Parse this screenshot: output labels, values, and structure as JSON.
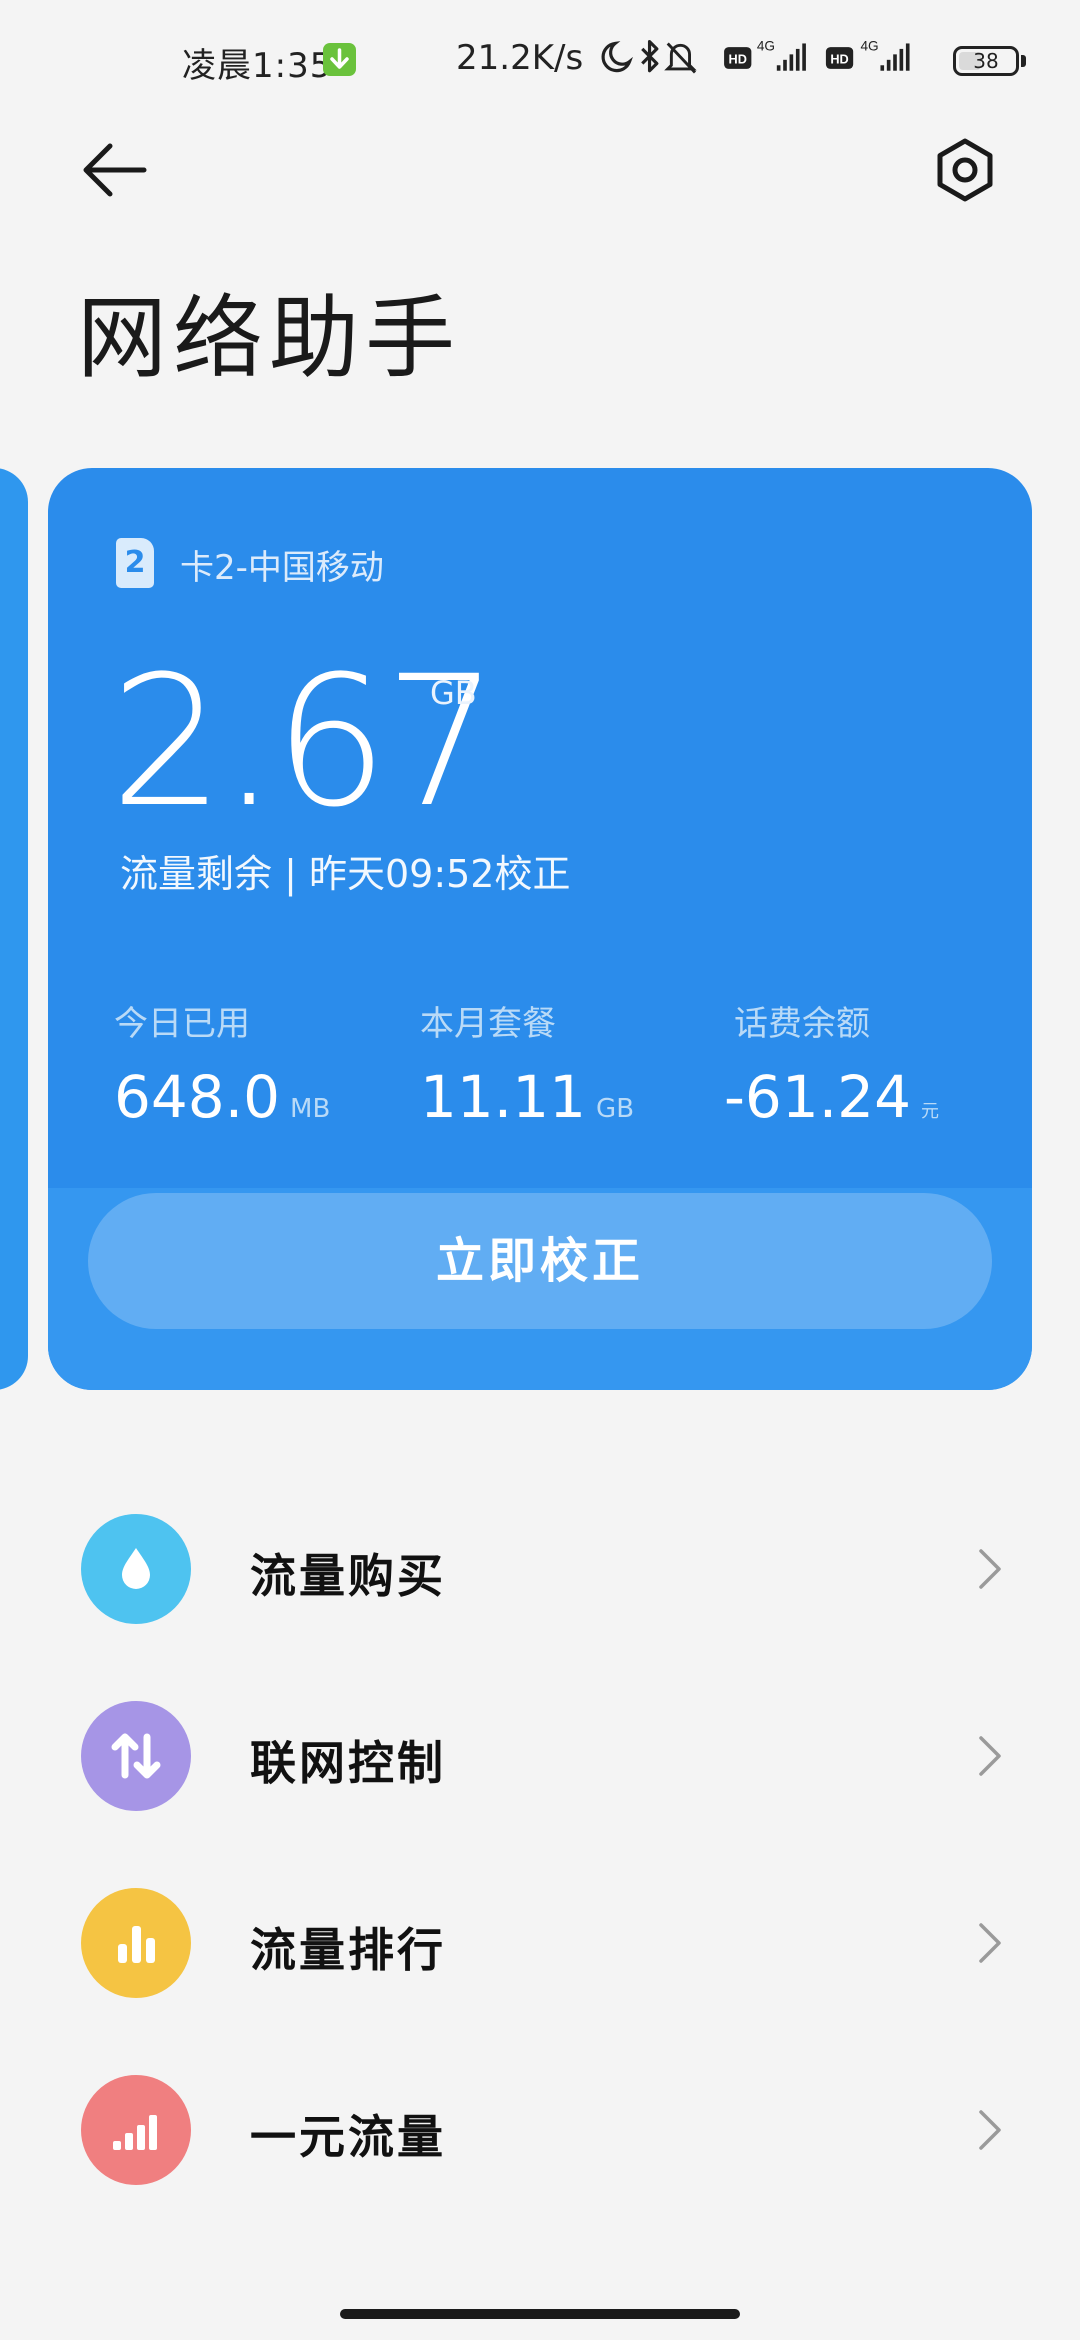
{
  "status_bar": {
    "time": "凌晨1:35",
    "net_speed": "21.2K/s",
    "battery": "38",
    "icons": [
      "download-icon",
      "moon-icon",
      "bluetooth-icon",
      "mute-icon",
      "hd-icon",
      "4g-signal-icon",
      "hd-icon",
      "4g-signal-icon",
      "battery-icon"
    ]
  },
  "header": {
    "title": "网络助手",
    "back_icon": "back-arrow-icon",
    "settings_icon": "settings-hex-icon"
  },
  "card": {
    "sim_number": "2",
    "carrier": "卡2-中国移动",
    "remaining_value": "2.67",
    "remaining_unit": "GB",
    "remaining_line": "流量剩余 | 昨天09:52校正",
    "stats": [
      {
        "label": "今日已用",
        "value": "648.0",
        "unit": "MB"
      },
      {
        "label": "本月套餐",
        "value": "11.11",
        "unit": "GB"
      },
      {
        "label": "话费余额",
        "value": "-61.24",
        "unit": "元"
      }
    ],
    "button": "立即校正",
    "colors": {
      "card_bg": "#2b8ceb",
      "peek_card_bg": "#2f97ee"
    }
  },
  "menu": [
    {
      "label": "流量购买",
      "icon": "water-drop-icon",
      "color": "#4ec3f0"
    },
    {
      "label": "联网控制",
      "icon": "up-down-arrows-icon",
      "color": "#a695e6"
    },
    {
      "label": "流量排行",
      "icon": "bar-chart-icon",
      "color": "#f5c443"
    },
    {
      "label": "一元流量",
      "icon": "signal-bars-icon",
      "color": "#f07f80"
    }
  ]
}
